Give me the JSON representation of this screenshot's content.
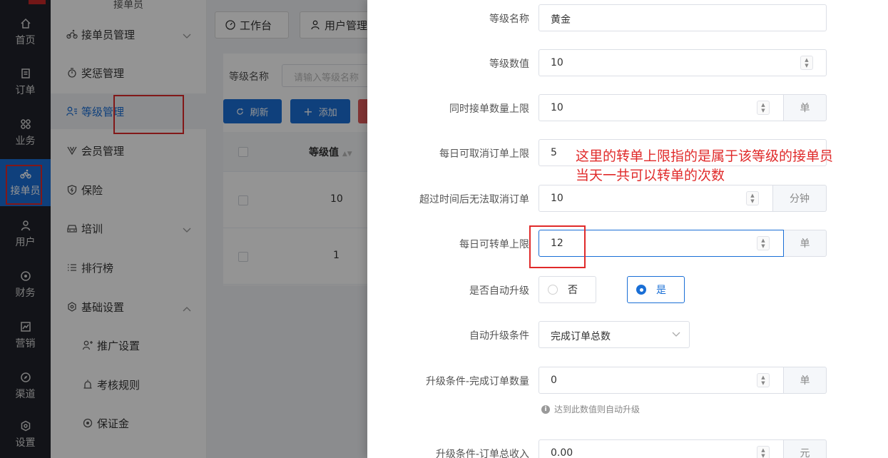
{
  "rail": {
    "items": [
      {
        "label": "首页",
        "icon": "home-icon"
      },
      {
        "label": "订单",
        "icon": "order-icon"
      },
      {
        "label": "业务",
        "icon": "grid-icon"
      },
      {
        "label": "接单员",
        "icon": "bike-icon"
      },
      {
        "label": "用户",
        "icon": "user-icon"
      },
      {
        "label": "财务",
        "icon": "coin-icon"
      },
      {
        "label": "营销",
        "icon": "chart-icon"
      },
      {
        "label": "渠道",
        "icon": "compass-icon"
      },
      {
        "label": "设置",
        "icon": "settings-icon"
      }
    ]
  },
  "submenu": {
    "header": "接单员",
    "items": [
      {
        "label": "接单员管理"
      },
      {
        "label": "奖惩管理"
      },
      {
        "label": "等级管理"
      },
      {
        "label": "会员管理"
      },
      {
        "label": "保险"
      },
      {
        "label": "培训"
      },
      {
        "label": "排行榜"
      },
      {
        "label": "基础设置"
      },
      {
        "label": "推广设置"
      },
      {
        "label": "考核规则"
      },
      {
        "label": "保证金"
      }
    ]
  },
  "tabs": {
    "workbench": "工作台",
    "users": "用户管理"
  },
  "list": {
    "filter_label": "等级名称",
    "filter_placeholder": "请输入等级名称",
    "refresh_label": "刷新",
    "add_label": "添加",
    "col_level_value": "等级值",
    "rows": [
      "10",
      "1"
    ]
  },
  "form": {
    "level_name": {
      "label": "等级名称",
      "value": "黄金"
    },
    "level_value": {
      "label": "等级数值",
      "value": "10"
    },
    "concurrent_limit": {
      "label": "同时接单数量上限",
      "value": "10",
      "unit": "单"
    },
    "daily_cancel_limit": {
      "label": "每日可取消订单上限",
      "value": "5"
    },
    "cancel_timeout": {
      "label": "超过时间后无法取消订单",
      "value": "10",
      "unit": "分钟"
    },
    "daily_transfer_limit": {
      "label": "每日可转单上限",
      "value": "12",
      "unit": "单"
    },
    "auto_upgrade": {
      "label": "是否自动升级",
      "no": "否",
      "yes": "是"
    },
    "upgrade_condition": {
      "label": "自动升级条件",
      "value": "完成订单总数"
    },
    "upgrade_orders": {
      "label": "升级条件-完成订单数量",
      "value": "0",
      "unit": "单",
      "hint": "达到此数值则自动升级"
    },
    "upgrade_income": {
      "label": "升级条件-订单总收入",
      "value": "0.00",
      "unit": "元"
    }
  },
  "annotation": {
    "line1": "这里的转单上限指的是属于该等级的接单员",
    "line2": "当天一共可以转单的次数"
  },
  "colors": {
    "accent": "#1a6fd6",
    "annotation": "#e02a2a",
    "rail": "#20222a"
  }
}
